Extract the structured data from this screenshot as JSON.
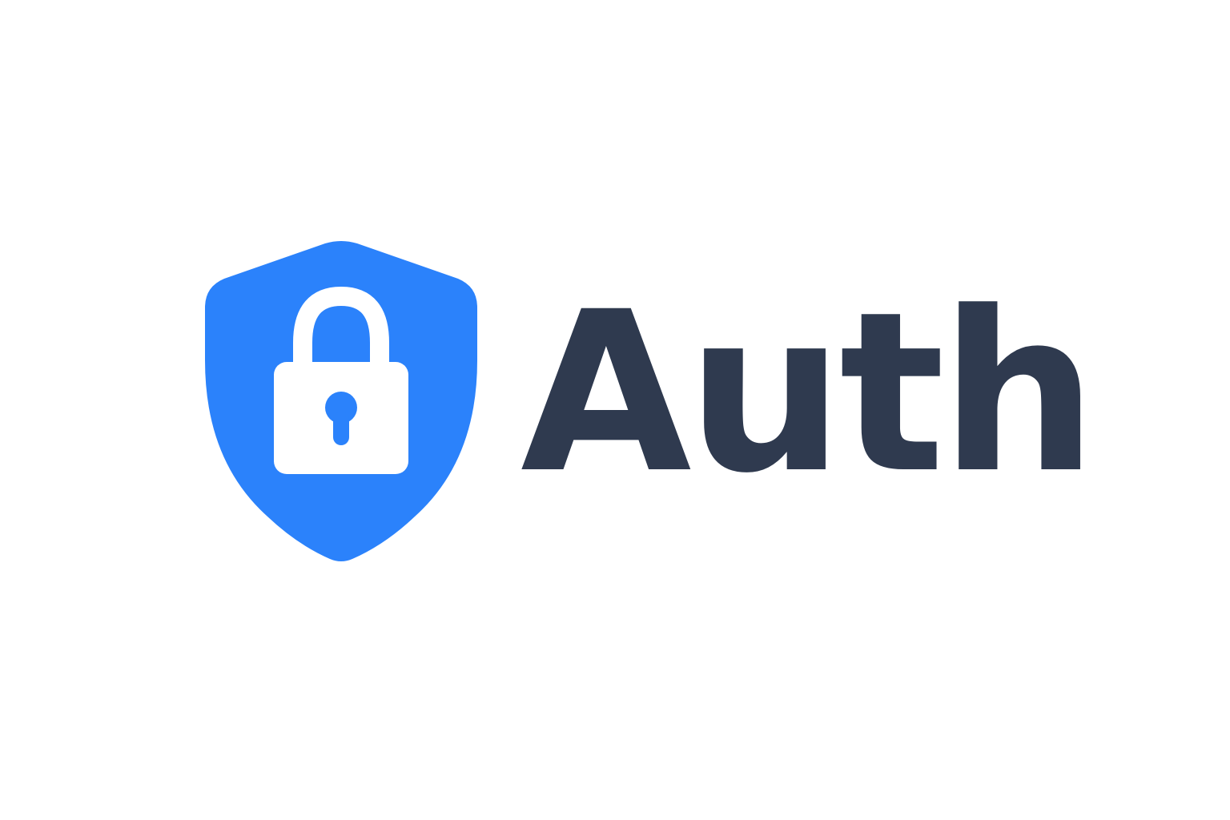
{
  "brand": {
    "name": "Auth",
    "text_color": "#2f3a4f",
    "shield_color": "#2b82fb",
    "lock_color": "#ffffff"
  },
  "icons": {
    "shield": "shield-icon",
    "lock": "lock-icon",
    "keyhole": "keyhole-icon"
  }
}
